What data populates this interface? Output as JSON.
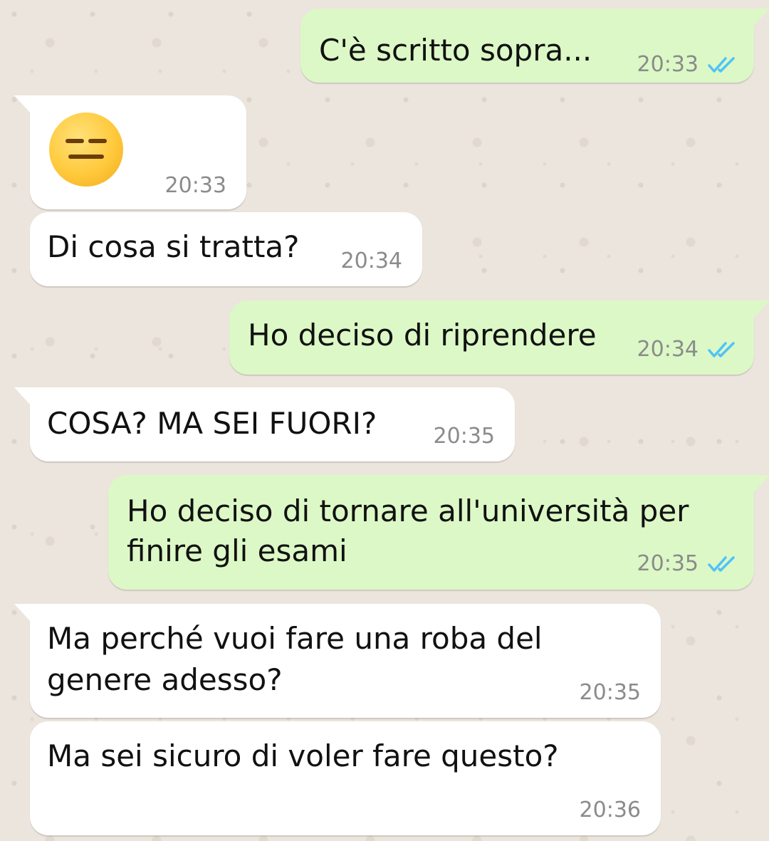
{
  "messages": [
    {
      "id": 1,
      "direction": "outgoing",
      "text_lines": [
        "C'è scritto sopra..."
      ],
      "time": "20:33",
      "status_icon": "double-check-icon",
      "status_color": "#4FC3F7"
    },
    {
      "id": 2,
      "direction": "incoming",
      "emoji": "expressionless-face-emoji",
      "time": "20:33"
    },
    {
      "id": 3,
      "direction": "incoming",
      "text_lines": [
        "Di cosa si tratta?"
      ],
      "time": "20:34"
    },
    {
      "id": 4,
      "direction": "outgoing",
      "text_lines": [
        "Ho deciso di riprendere"
      ],
      "time": "20:34",
      "status_icon": "double-check-icon",
      "status_color": "#4FC3F7"
    },
    {
      "id": 5,
      "direction": "incoming",
      "text_lines": [
        "COSA? MA SEI FUORI?"
      ],
      "time": "20:35"
    },
    {
      "id": 6,
      "direction": "outgoing",
      "text_lines": [
        "Ho deciso di tornare all'università per",
        "finire gli esami"
      ],
      "time": "20:35",
      "status_icon": "double-check-icon",
      "status_color": "#4FC3F7"
    },
    {
      "id": 7,
      "direction": "incoming",
      "text_lines": [
        "Ma perché vuoi fare una roba del",
        "genere adesso?"
      ],
      "time": "20:35"
    },
    {
      "id": 8,
      "direction": "incoming",
      "text_lines": [
        "Ma sei sicuro di voler fare questo?"
      ],
      "time": "20:36"
    }
  ],
  "colors": {
    "background": "#ECE5DD",
    "incoming_bubble": "#FFFFFF",
    "outgoing_bubble": "#DCF8C6",
    "time_text": "#8B8B8B",
    "read_check": "#4FC3F7"
  }
}
